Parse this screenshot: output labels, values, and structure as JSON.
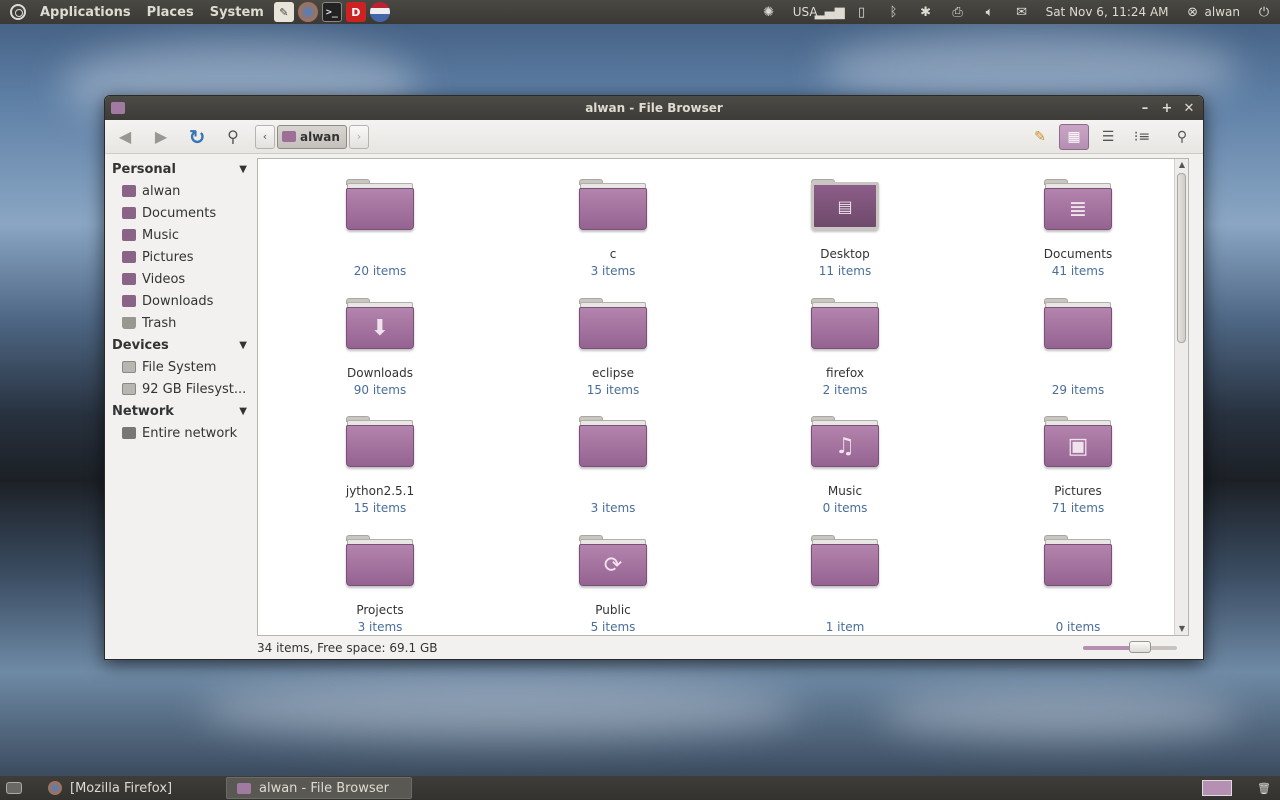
{
  "top_panel": {
    "menus": [
      "Applications",
      "Places",
      "System"
    ],
    "keyboard_layout": "USA",
    "datetime": "Sat Nov  6, 11:24 AM",
    "user": "alwan"
  },
  "window": {
    "title": "alwan - File Browser",
    "path_current": "alwan"
  },
  "sidebar": {
    "sections": [
      {
        "header": "Personal",
        "items": [
          "alwan",
          "Documents",
          "Music",
          "Pictures",
          "Videos",
          "Downloads",
          "Trash"
        ]
      },
      {
        "header": "Devices",
        "items": [
          "File System",
          "92 GB Filesyst..."
        ]
      },
      {
        "header": "Network",
        "items": [
          "Entire network"
        ]
      }
    ]
  },
  "files": [
    {
      "name": "",
      "count": "20 items",
      "glyph": ""
    },
    {
      "name": "c",
      "count": "3 items",
      "glyph": ""
    },
    {
      "name": "Desktop",
      "count": "11 items",
      "glyph": "desktop"
    },
    {
      "name": "Documents",
      "count": "41 items",
      "glyph": "≣"
    },
    {
      "name": "Downloads",
      "count": "90 items",
      "glyph": "⬇"
    },
    {
      "name": "eclipse",
      "count": "15 items",
      "glyph": ""
    },
    {
      "name": "firefox",
      "count": "2 items",
      "glyph": ""
    },
    {
      "name": "",
      "count": "29 items",
      "glyph": ""
    },
    {
      "name": "jython2.5.1",
      "count": "15 items",
      "glyph": ""
    },
    {
      "name": "",
      "count": "3 items",
      "glyph": ""
    },
    {
      "name": "Music",
      "count": "0 items",
      "glyph": "♫"
    },
    {
      "name": "Pictures",
      "count": "71 items",
      "glyph": "▣"
    },
    {
      "name": "Projects",
      "count": "3 items",
      "glyph": ""
    },
    {
      "name": "Public",
      "count": "5 items",
      "glyph": "⟳"
    },
    {
      "name": "",
      "count": "1 item",
      "glyph": ""
    },
    {
      "name": "",
      "count": "0 items",
      "glyph": ""
    }
  ],
  "statusbar": {
    "text": "34 items, Free space: 69.1 GB"
  },
  "taskbar": {
    "tasks": [
      "[Mozilla Firefox]",
      "alwan - File Browser"
    ]
  }
}
